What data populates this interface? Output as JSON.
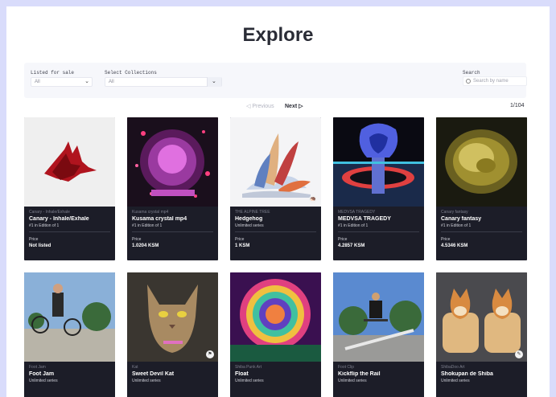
{
  "page": {
    "title": "Explore"
  },
  "filters": {
    "listed_label": "Listed for sale",
    "listed_value": "All",
    "collections_label": "Select Collections",
    "collections_value": "All",
    "search_label": "Search",
    "search_placeholder": "Search by name"
  },
  "pagination": {
    "previous": "◁ Previous",
    "next": "Next ▷",
    "count": "1/104"
  },
  "cards": [
    {
      "collection": "Canary - Inhale/Exhale",
      "name": "Canary - Inhale/Exhale",
      "edition": "#1 in Edition of 1",
      "price_label": "Price",
      "price": "Not listed"
    },
    {
      "collection": "Kusama crystal mp4",
      "name": "Kusama crystal mp4",
      "edition": "#1 in Edition of 1",
      "price_label": "Price",
      "price": "1.0204 KSM"
    },
    {
      "collection": "THE ALPINE TREE",
      "name": "Hedgehog",
      "edition": "Unlimited series",
      "price_label": "Price",
      "price": "1 KSM"
    },
    {
      "collection": "MEDVSA TRAGEDY",
      "name": "MEDVSA TRAGEDY",
      "edition": "#1 in Edition of 1",
      "price_label": "Price",
      "price": "4.2857 KSM"
    },
    {
      "collection": "Canary fantasy",
      "name": "Canary fantasy",
      "edition": "#1 in Edition of 1",
      "price_label": "Price",
      "price": "4.5346 KSM"
    },
    {
      "collection": "Foot Jam",
      "name": "Foot Jam",
      "edition": "Unlimited series"
    },
    {
      "collection": "Kat",
      "name": "Sweet Devil Kat",
      "edition": "Unlimited series"
    },
    {
      "collection": "Shiba Punk Art",
      "name": "Float",
      "edition": "Unlimited series"
    },
    {
      "collection": "Foot Clip",
      "name": "Kickflip the Rail",
      "edition": "Unlimited series"
    },
    {
      "collection": "ShibaDoo Art",
      "name": "Shokupan de Shiba",
      "edition": "Unlimited series"
    }
  ]
}
